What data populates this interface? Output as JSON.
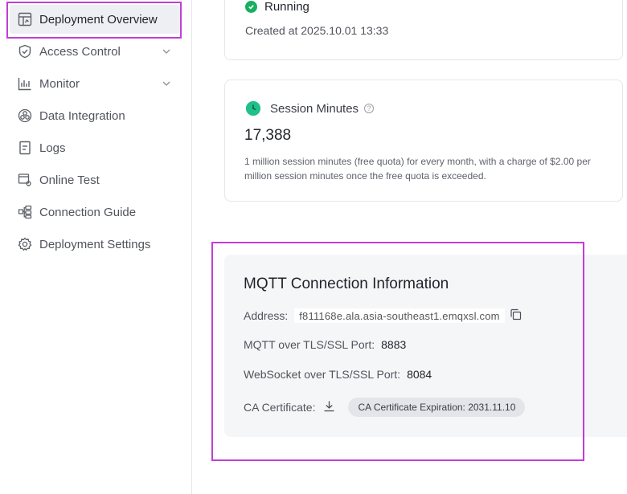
{
  "sidebar": {
    "items": [
      {
        "label": "Deployment Overview",
        "icon": "dashboard-icon"
      },
      {
        "label": "Access Control",
        "icon": "shield-check-icon"
      },
      {
        "label": "Monitor",
        "icon": "bar-chart-icon"
      },
      {
        "label": "Data Integration",
        "icon": "integration-icon"
      },
      {
        "label": "Logs",
        "icon": "document-icon"
      },
      {
        "label": "Online Test",
        "icon": "online-test-icon"
      },
      {
        "label": "Connection Guide",
        "icon": "connection-guide-icon"
      },
      {
        "label": "Deployment Settings",
        "icon": "gear-icon"
      }
    ],
    "active_index": 0
  },
  "status": {
    "label": "Running",
    "created": "Created at 2025.10.01 13:33",
    "color": "#16b05e"
  },
  "session": {
    "title": "Session Minutes",
    "value": "17,388",
    "description": "1 million session minutes (free quota) for every month, with a charge of $2.00 per million session minutes once the free quota is exceeded."
  },
  "mqtt": {
    "title": "MQTT Connection Information",
    "address_label": "Address:",
    "address_value": "f811168e.ala.asia-southeast1.emqxsl.com",
    "tls_port_label": "MQTT over TLS/SSL Port:",
    "tls_port_value": "8883",
    "ws_port_label": "WebSocket over TLS/SSL Port:",
    "ws_port_value": "8084",
    "ca_label": "CA Certificate:",
    "ca_expiration": "CA Certificate Expiration: 2031.11.10"
  },
  "colors": {
    "highlight": "#c13ed6",
    "accent_green": "#20c08a"
  }
}
